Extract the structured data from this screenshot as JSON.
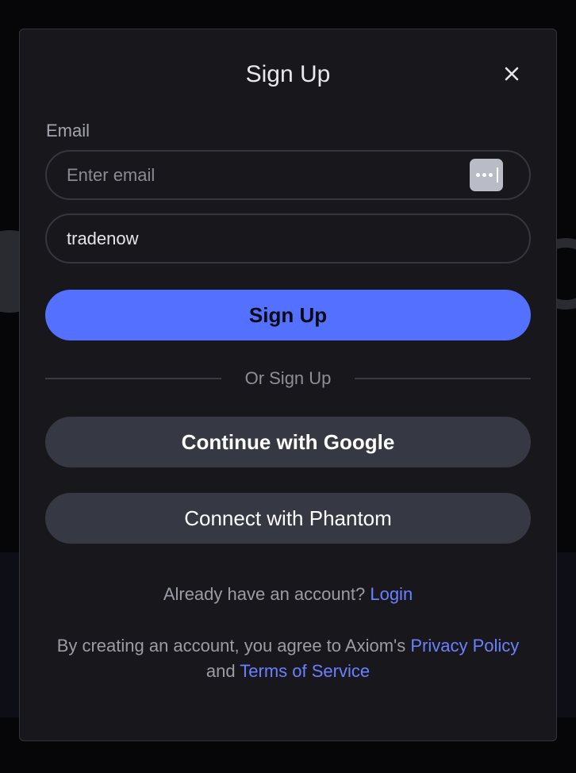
{
  "modal": {
    "title": "Sign Up",
    "close_icon": "close-icon"
  },
  "form": {
    "email_label": "Email",
    "email_placeholder": "Enter email",
    "email_value": "",
    "password_manager_icon": "password-manager-icon",
    "second_field_value": "tradenow",
    "submit_label": "Sign Up"
  },
  "divider": {
    "text": "Or Sign Up"
  },
  "social": {
    "google_label": "Continue with Google",
    "phantom_label": "Connect with Phantom"
  },
  "footer": {
    "login_prompt": "Already have an account?",
    "login_link": "Login",
    "legal_prefix": "By creating an account, you agree to Axiom's",
    "privacy_link": "Privacy Policy",
    "legal_and": "and",
    "terms_link": "Terms of Service"
  },
  "colors": {
    "accent": "#5470ff",
    "link": "#6b80ff",
    "modal_bg": "#18181c",
    "social_button_bg": "#363843"
  }
}
